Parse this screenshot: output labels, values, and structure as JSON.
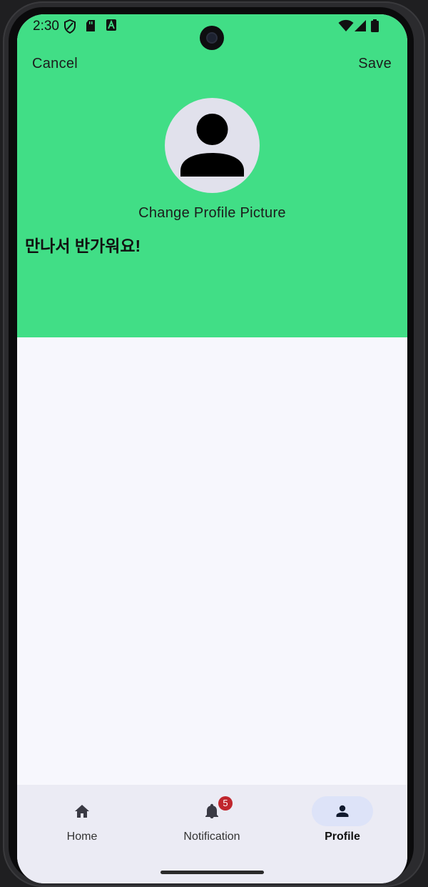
{
  "status_bar": {
    "time": "2:30"
  },
  "header": {
    "cancel_label": "Cancel",
    "save_label": "Save",
    "change_picture_label": "Change Profile Picture",
    "greeting": "만나서 반가워요!"
  },
  "nav": {
    "items": [
      {
        "label": "Home",
        "icon": "home-icon"
      },
      {
        "label": "Notification",
        "icon": "bell-icon",
        "badge": "5"
      },
      {
        "label": "Profile",
        "icon": "person-icon"
      }
    ],
    "active": "Profile"
  },
  "colors": {
    "header_bg": "#41de86",
    "content_bg": "#f7f7fd",
    "nav_bg": "#ebebf4",
    "active_pill": "#dde3f8",
    "badge": "#c0262d"
  }
}
